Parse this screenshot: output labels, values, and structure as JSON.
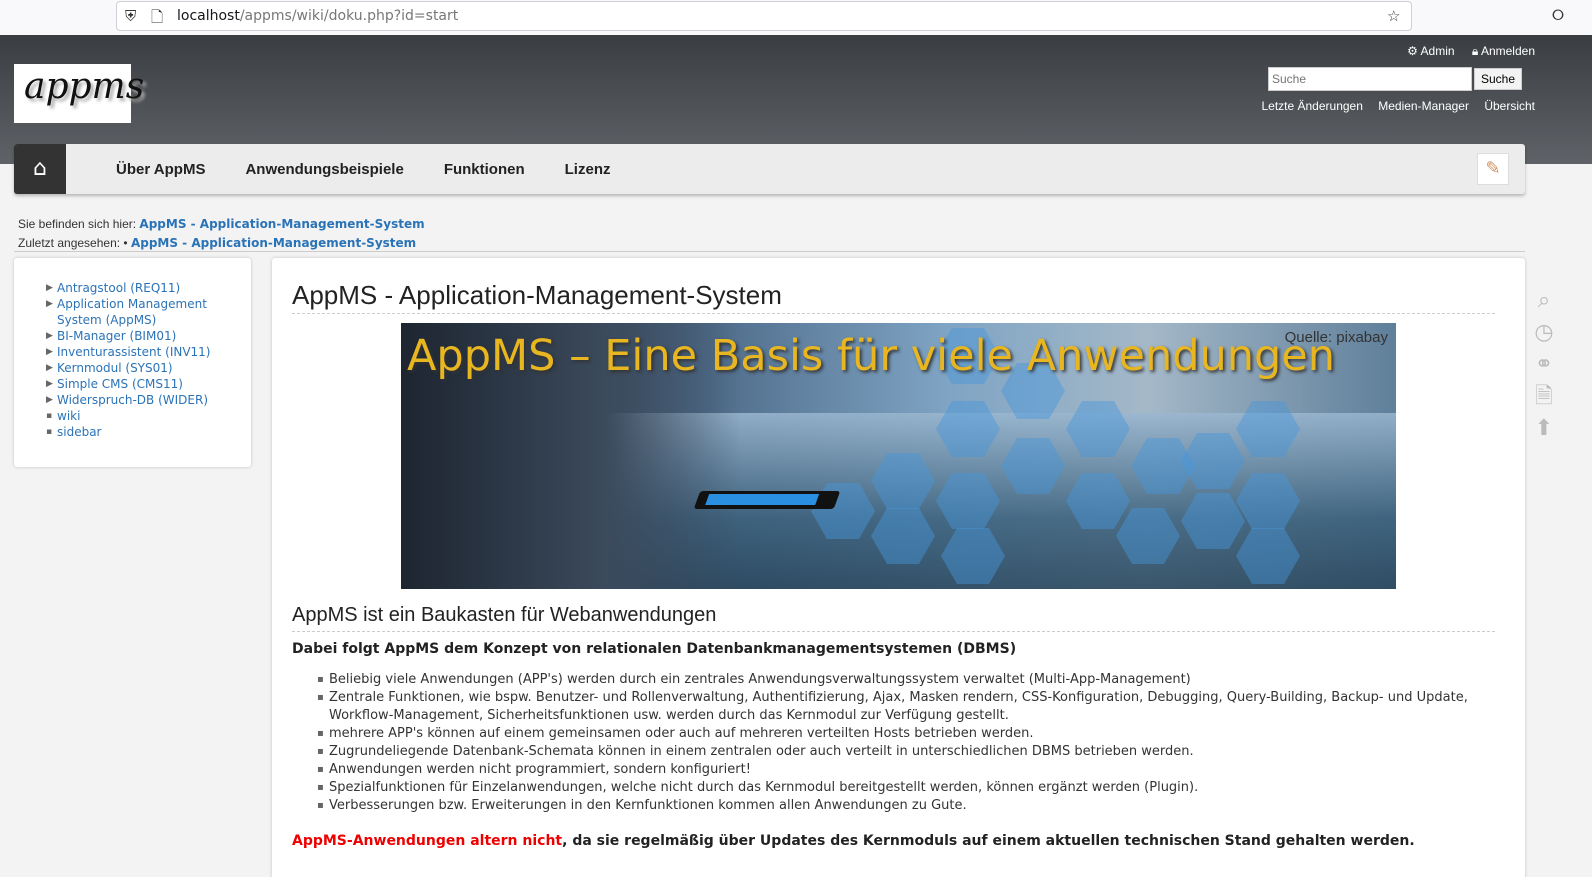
{
  "browser": {
    "url_host": "localhost",
    "url_path": "/appms/wiki/doku.php?id=start"
  },
  "header": {
    "logo_text": "appms",
    "user_tools": [
      "Admin",
      "Anmelden"
    ],
    "search_placeholder": "Suche",
    "search_button": "Suche",
    "site_tools": [
      "Letzte Änderungen",
      "Medien-Manager",
      "Übersicht"
    ]
  },
  "nav": {
    "items": [
      "Über AppMS",
      "Anwendungsbeispiele",
      "Funktionen",
      "Lizenz"
    ]
  },
  "breadcrumbs": {
    "trace_label": "Sie befinden sich hier:",
    "trace_link": "AppMS - Application-Management-System",
    "recent_label": "Zuletzt angesehen:",
    "recent_link": "AppMS - Application-Management-System"
  },
  "sidebar": {
    "items": [
      "Antragstool (REQ11)",
      "Application Management System (AppMS)",
      "BI-Manager (BIM01)",
      "Inventurassistent (INV11)",
      "Kernmodul (SYS01)",
      "Simple CMS (CMS11)",
      "Widerspruch-DB (WIDER)",
      "wiki",
      "sidebar"
    ]
  },
  "content": {
    "title": "AppMS - Application-Management-System",
    "banner_title": "AppMS – Eine Basis für viele Anwendungen",
    "banner_source": "Quelle: pixabay",
    "heading": "AppMS ist ein Baukasten für Webanwendungen",
    "lead": "Dabei folgt AppMS dem Konzept von relationalen Datenbankmanagementsystemen (DBMS)",
    "bullets": [
      "Beliebig viele Anwendungen (APP's) werden durch ein zentrales Anwendungsverwaltungssystem verwaltet (Multi-App-Management)",
      "Zentrale Funktionen, wie bspw. Benutzer- und Rollenverwaltung, Authentifizierung, Ajax, Masken rendern, CSS-Konfiguration, Debugging, Query-Building, Backup- und Update, Workflow-Management, Sicherheitsfunktionen usw. werden durch das Kernmodul zur Verfügung gestellt.",
      "mehrere APP's können auf einem gemeinsamen oder auch auf mehreren verteilten Hosts betrieben werden.",
      "Zugrundeliegende Datenbank-Schemata können in einem zentralen oder auch verteilt in unterschiedlichen DBMS betrieben werden.",
      "Anwendungen werden nicht programmiert, sondern konfiguriert!",
      "Spezialfunktionen für Einzelanwendungen, welche nicht durch das Kernmodul bereitgestellt werden, können ergänzt werden (Plugin).",
      "Verbesserungen bzw. Erweiterungen in den Kernfunktionen kommen allen Anwendungen zu Gute."
    ],
    "closing_red": "AppMS-Anwendungen altern nicht",
    "closing_rest": ", da sie regelmäßig über Updates des Kernmoduls auf einem aktuellen technischen Stand gehalten werden."
  },
  "page_tools": [
    "search-icon",
    "history-icon",
    "backlinks-icon",
    "pdf-icon",
    "back-to-top-icon"
  ]
}
